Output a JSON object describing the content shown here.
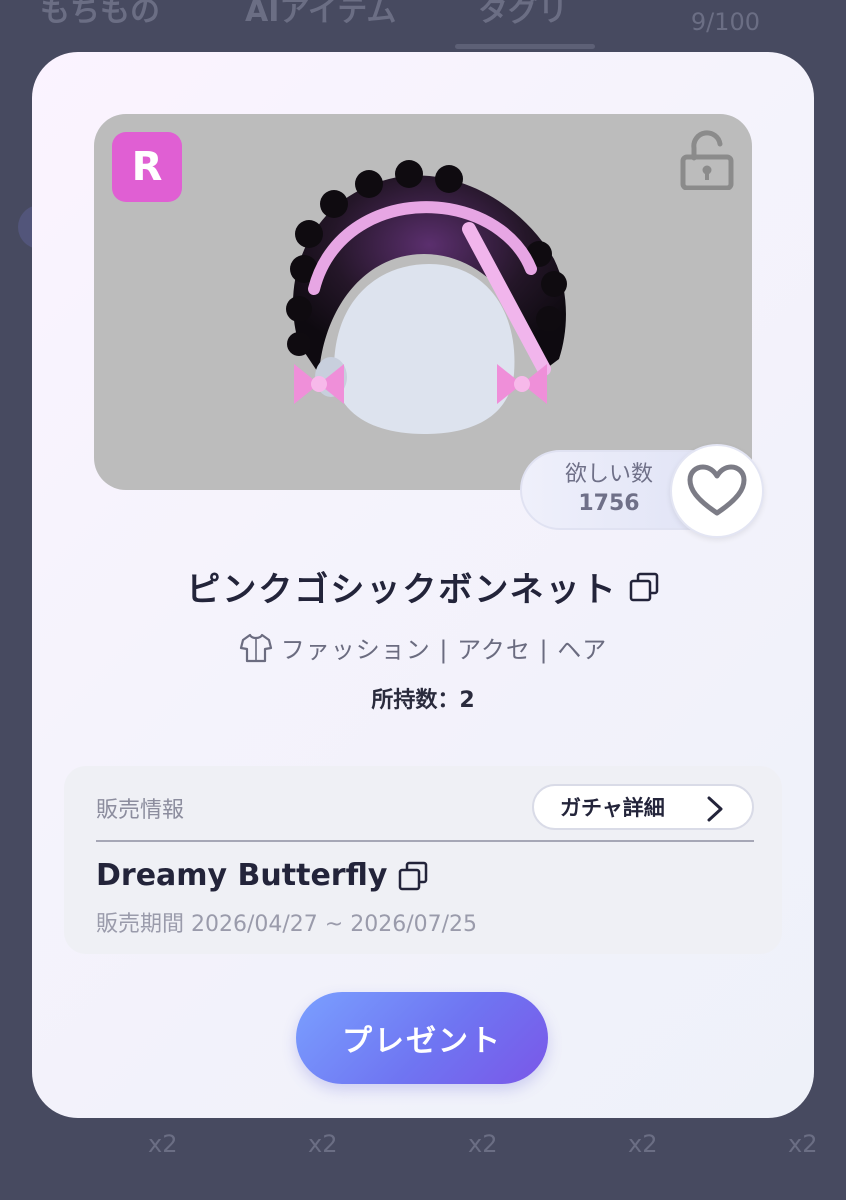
{
  "background": {
    "tabs": [
      "もちもの",
      "AIアイテム",
      "タグリ"
    ],
    "count_label": "9/100",
    "item_counts": [
      "x2",
      "x2",
      "x2",
      "x2",
      "x2"
    ]
  },
  "modal": {
    "rarity": "R",
    "want": {
      "label": "欲しい数",
      "count": "1756"
    },
    "item_name": "ピンクゴシックボンネット",
    "category": "ファッション | アクセ | ヘア",
    "owned": "所持数：2",
    "sales": {
      "label": "販売情報",
      "gacha_button": "ガチャ詳細",
      "gacha_name": "Dreamy Butterfly",
      "period": "販売期間 2026/04/27 ~ 2026/07/25"
    },
    "present_button": "プレゼント"
  },
  "colors": {
    "accent_pink": "#e05fd3",
    "button_gradient_start": "#7aa0ff",
    "button_gradient_end": "#7a57e8",
    "overlay": "#474a60"
  },
  "icons": [
    "lock-icon",
    "heart-icon",
    "copy-icon",
    "shirt-icon",
    "chevron-right-icon"
  ]
}
